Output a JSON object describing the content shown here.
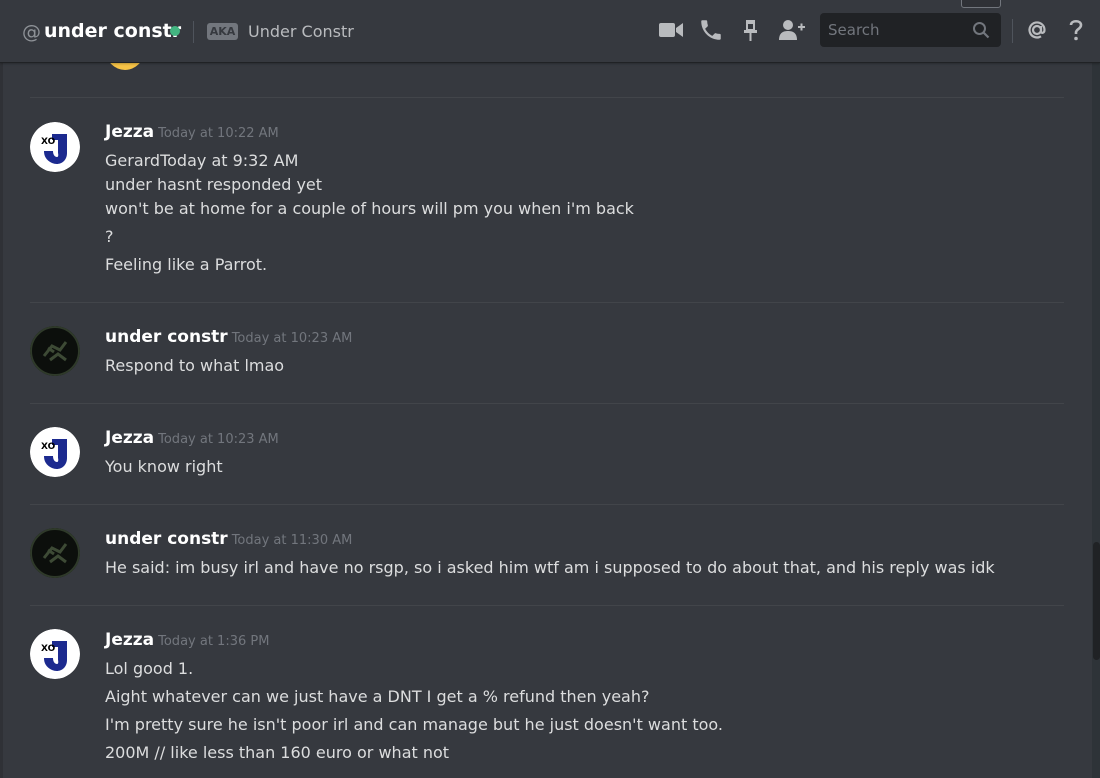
{
  "header": {
    "at_symbol": "@",
    "channel_name": "under constr",
    "status": "online",
    "aka_label": "AKA",
    "nickname": "Under Constr",
    "search_placeholder": "Search",
    "icons": [
      "video-call-icon",
      "voice-call-icon",
      "pin-icon",
      "add-friend-icon",
      "search-icon",
      "mention-icon",
      "help-icon"
    ]
  },
  "colors": {
    "background": "#36393f",
    "status_online": "#43b581",
    "timestamp": "#72767d",
    "separator": "#42454a"
  },
  "messages": [
    {
      "author": "Jezza",
      "timestamp": "Today at 10:22 AM",
      "avatar": "jezza-avatar",
      "lines": [
        "GerardToday at 9:32 AM",
        "under hasnt responded yet",
        "won't be at home for a couple of hours will pm you when i'm back",
        "?",
        "Feeling like a Parrot."
      ]
    },
    {
      "author": "under constr",
      "timestamp": "Today at 10:23 AM",
      "avatar": "under-constr-avatar",
      "lines": [
        "Respond to what lmao"
      ]
    },
    {
      "author": "Jezza",
      "timestamp": "Today at 10:23 AM",
      "avatar": "jezza-avatar",
      "lines": [
        "You know right"
      ]
    },
    {
      "author": "under constr",
      "timestamp": "Today at 11:30 AM",
      "avatar": "under-constr-avatar",
      "lines": [
        "He said: im busy irl and have no rsgp, so i asked him wtf am i supposed to do about that, and his reply was idk"
      ]
    },
    {
      "author": "Jezza",
      "timestamp": "Today at 1:36 PM",
      "avatar": "jezza-avatar",
      "lines": [
        "Lol good 1.",
        "Aight whatever can we just have a DNT I get a % refund then yeah?",
        "I'm pretty sure he isn't poor irl and can manage but he just doesn't want too.",
        "200M // like less than 160 euro or what not"
      ]
    }
  ]
}
